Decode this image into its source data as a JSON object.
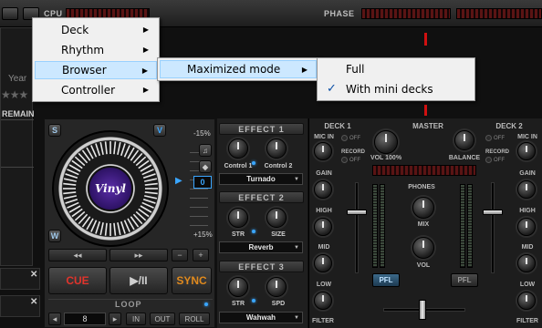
{
  "topbar": {
    "cpu_label": "CPU",
    "phase_label": "PHASE"
  },
  "left_browser": {
    "year_label": "Year",
    "remain_label": "REMAIN",
    "close_glyph": "✕"
  },
  "deck1": {
    "side_buttons": [
      "S",
      "V",
      "W"
    ],
    "platter_label": "Vinyl",
    "pitch_top": "-15%",
    "pitch_bottom": "+15%",
    "pitch_value": "0",
    "pitch_step_minus": "−",
    "pitch_step_plus": "+",
    "rewind_glyph": "◂◂",
    "forward_glyph": "▸▸",
    "cue_label": "CUE",
    "play_label": "▶/II",
    "sync_label": "SYNC",
    "loop_label": "LOOP",
    "loop_value": "8",
    "loop_in": "IN",
    "loop_out": "OUT",
    "loop_roll": "ROLL",
    "loop_prev": "◂",
    "loop_next": "▸",
    "effects": [
      {
        "title": "EFFECT 1",
        "knob1": "Control 1",
        "knob2": "Control 2",
        "selected": "Turnado"
      },
      {
        "title": "EFFECT 2",
        "knob1": "STR",
        "knob2": "SIZE",
        "selected": "Reverb"
      },
      {
        "title": "EFFECT 3",
        "knob1": "STR",
        "knob2": "SPD",
        "selected": "Wahwah"
      }
    ]
  },
  "mixer": {
    "deck1_label": "DECK 1",
    "master_label": "MASTER",
    "deck2_label": "DECK 2",
    "mic_in": "MIC IN",
    "off": "OFF",
    "record": "RECORD",
    "gain": "GAIN",
    "high": "HIGH",
    "mid": "MID",
    "low": "LOW",
    "filter": "FILTER",
    "vol_100": "VOL 100%",
    "balance": "BALANCE",
    "phones": "PHONES",
    "mix": "MIX",
    "vol": "VOL",
    "pfl": "PFL"
  },
  "context_menu": {
    "main_items": [
      {
        "label": "Deck",
        "has_submenu": true
      },
      {
        "label": "Rhythm",
        "has_submenu": true
      },
      {
        "label": "Browser",
        "has_submenu": true,
        "highlighted": true
      },
      {
        "label": "Controller",
        "has_submenu": true
      }
    ],
    "browser_submenu": [
      {
        "label": "Maximized mode",
        "has_submenu": true,
        "highlighted": true
      }
    ],
    "maximized_submenu": [
      {
        "label": "Full",
        "checked": false
      },
      {
        "label": "With mini decks",
        "checked": true
      }
    ],
    "submenu_arrow": "▶",
    "check_glyph": "✓"
  },
  "colors": {
    "accent_blue": "#3aa6ff",
    "cue_red": "#e0342c",
    "sync_orange": "#e08a1e",
    "menu_highlight": "#cce8ff",
    "phase_marker": "#d01010"
  }
}
